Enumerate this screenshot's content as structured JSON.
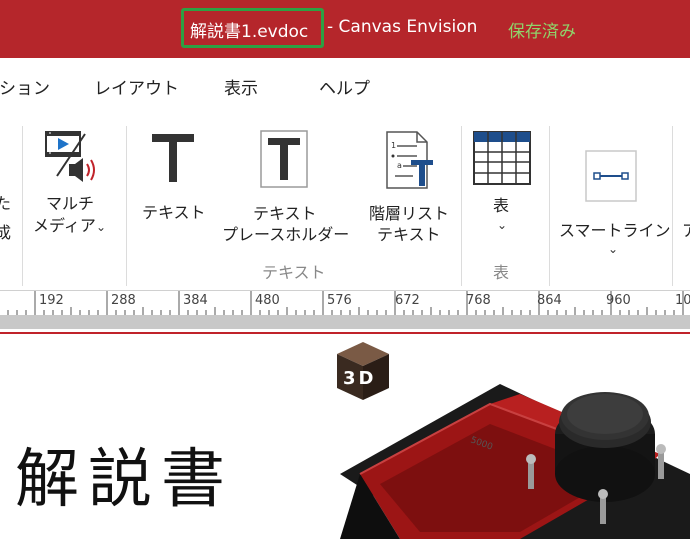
{
  "titlebar": {
    "document_name": "解説書1.evdoc",
    "app_name": "- Canvas Envision",
    "save_status": "保存済み"
  },
  "menu": {
    "partial_item": "ション",
    "items": [
      "レイアウト",
      "表示",
      "ヘルプ"
    ]
  },
  "ribbon": {
    "partial_left_chars": [
      "た",
      "成"
    ],
    "multimedia": {
      "line1": "マルチ",
      "line2": "メディア"
    },
    "text": "テキスト",
    "text_placeholder": {
      "line1": "テキスト",
      "line2": "プレースホルダー"
    },
    "hier_list": {
      "line1": "階層リスト",
      "line2": "テキスト"
    },
    "table": "表",
    "smartline": "スマートライン",
    "partial_right": "ア",
    "group_text": "テキスト",
    "group_table": "表"
  },
  "ruler": {
    "ticks": [
      "192",
      "288",
      "384",
      "480",
      "576",
      "672",
      "768",
      "864",
      "960",
      "10"
    ]
  },
  "canvas": {
    "badge_3d": "3D",
    "heading": "解説書"
  },
  "colors": {
    "titlebar": "#b5262b",
    "highlight_box": "#2ea043",
    "save_status": "#8fd46b",
    "accent_red": "#c0232a",
    "model_red": "#9c1515"
  }
}
